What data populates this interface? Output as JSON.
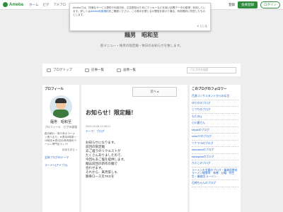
{
  "topbar": {
    "logo": "Ameba",
    "nav": [
      "ホーム",
      "ピグ",
      "アメブロ"
    ],
    "login_label": "登録",
    "signup_label": "会員登録",
    "signin_label": "ログイン"
  },
  "notice": {
    "text_before": "Amebaでは、快適なサービス提供や利用分析、広告配信のためにクッキーなどを使い訪問データの取得・利用しています。詳しくは",
    "link": "Ameba利用規約",
    "text_after": "をご確認ください。この表示を閉じるか閲覧を続けた場合、利用規約に同意したものとします。",
    "close": "✕ とじる"
  },
  "header": {
    "title": "麺男　昭和至",
    "subtitle": "新メニュー・毎月の限定麺・休日のお知らせを致します。"
  },
  "navbar": {
    "items": [
      "ブログトップ",
      "記事一覧",
      "画像一覧"
    ],
    "search_placeholder": "ブログ内を検索"
  },
  "profile": {
    "heading": "プロフィール",
    "name": "麺男　昭和至",
    "link1": "プロフィール",
    "link2": "ピグの部屋",
    "desc": "森の鮮わ・魚介系のラーメン食べるモ。★週末8時発〜15時迄★週1回の希有極めラーメン専門店ランク!",
    "more": "読者を見る >",
    "theme": "全体ブログのテーマ",
    "theme2": "ラーメン(アメブロ)"
  },
  "entry": {
    "next_label": "次へ ▸",
    "title": "お知らせ！限定麺！",
    "date": "2022-03-08 12:08:21",
    "theme": "テーマ：ブログ",
    "body": [
      "お知らせになります。",
      "前回の限定麺",
      "あご塩ラのリクエストが",
      "たくさんありましたので、",
      "今回もあご塩を提供します。",
      "麺は前回の新作の麺で",
      "合わせます。",
      "それから、来月第しも",
      "豚骨ロース叉TKGを"
    ]
  },
  "follow": {
    "heading": "このブログのフォロワー",
    "items": [
      "百源コンサルタントからの伝言",
      "ゆりかのブログ",
      "じつちのブログ",
      "もたのQ",
      "小川建さん",
      "Miyakのブログ",
      "shiraTTのブログ",
      "ツナマヨのブログ",
      "dascakesのブログ",
      "kazuqukaのブログ",
      "かぶこのブログ",
      "ラーメン大名鑑のブログ・業務用食材　ラーメン雑食材　味噌　炒麺・釣生生・業務用 ラーメン",
      "石神ちゃんのブログ"
    ]
  }
}
